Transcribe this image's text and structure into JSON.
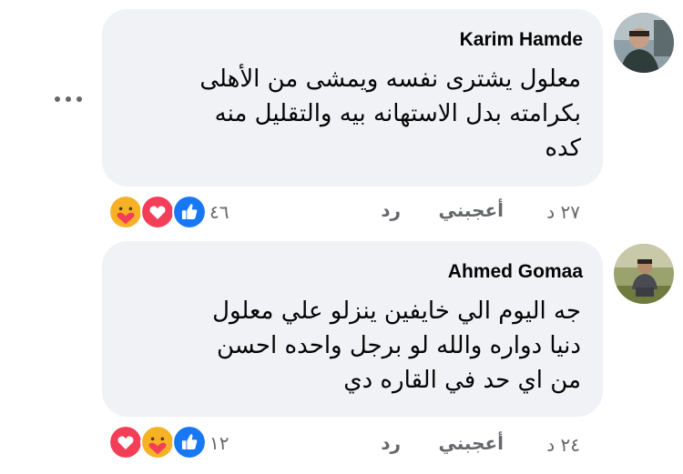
{
  "comments": [
    {
      "author": "Karim Hamde",
      "text_lines": [
        "معلول يشترى نفسه ويمشى من الأهلى",
        "بكرامته بدل الاستهانه بيه والتقليل منه",
        "كده"
      ],
      "time": "٢٧ د",
      "like_label": "أعجبني",
      "reply_label": "رد",
      "reaction_count": "٤٦",
      "reactions": [
        "care-icon",
        "love-icon",
        "like-icon"
      ]
    },
    {
      "author": "Ahmed Gomaa",
      "text_lines": [
        "جه اليوم الي خايفين ينزلو علي معلول",
        "دنيا دواره والله لو برجل واحده احسن",
        "من اي حد في القاره دي"
      ],
      "time": "٢٤ د",
      "like_label": "أعجبني",
      "reply_label": "رد",
      "reaction_count": "١٢",
      "reactions": [
        "love-icon",
        "care-icon",
        "like-icon"
      ]
    }
  ],
  "colors": {
    "bubble": "#f0f2f5",
    "text": "#050505",
    "meta": "#65676b",
    "like_blue": "#1877f2",
    "love_red": "#f33e58",
    "care_yellow": "#f7b125"
  }
}
